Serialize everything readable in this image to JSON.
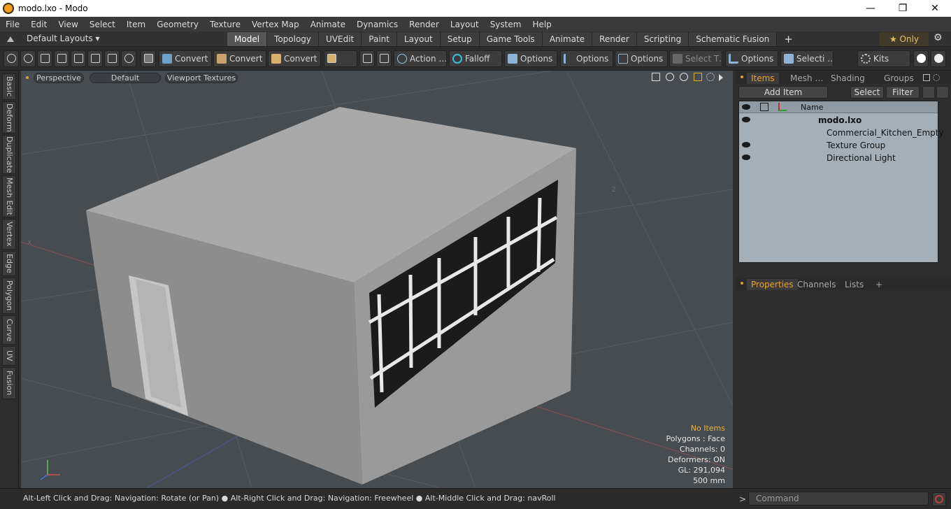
{
  "window": {
    "title": "modo.lxo - Modo",
    "minimize": "—",
    "maximize": "❐",
    "close": "✕"
  },
  "menu": [
    "File",
    "Edit",
    "View",
    "Select",
    "Item",
    "Geometry",
    "Texture",
    "Vertex Map",
    "Animate",
    "Dynamics",
    "Render",
    "Layout",
    "System",
    "Help"
  ],
  "layouts": {
    "label": "Default Layouts ▾",
    "tabs": [
      "Model",
      "Topology",
      "UVEdit",
      "Paint",
      "Layout",
      "Setup",
      "Game Tools",
      "Animate",
      "Render",
      "Scripting",
      "Schematic Fusion"
    ],
    "active": "Model",
    "add": "+",
    "only_label": "★ Only",
    "settings": "⚙"
  },
  "toolbar": {
    "convert1": "Convert",
    "convert2": "Convert",
    "convert3": "Convert",
    "action": "Action …",
    "falloff": "Falloff",
    "options1": "Options",
    "options2": "Options",
    "options3": "Options",
    "select_t": "Select T…",
    "options4": "Options",
    "selecti": "Selecti …",
    "kits": "Kits"
  },
  "left_tabs": [
    "Basic",
    "Deform",
    "Duplicate",
    "Mesh Edit",
    "Vertex",
    "Edge",
    "Polygon",
    "Curve",
    "UV",
    "Fusion"
  ],
  "viewport": {
    "perspective": "Perspective",
    "shading": "Default",
    "textures": "Viewport Textures",
    "axis_x": "X",
    "axis_z": "Z",
    "info": {
      "no_items": "No Items",
      "polygons": "Polygons : Face",
      "channels": "Channels: 0",
      "deformers": "Deformers: ON",
      "gl": "GL: 291,094",
      "scale": "500 mm"
    }
  },
  "items_panel": {
    "tabs": [
      "Items",
      "Mesh …",
      "Shading",
      "Groups"
    ],
    "active": "Items",
    "add_item": "Add Item",
    "select": "Select",
    "filter": "Filter",
    "name_header": "Name",
    "rows": [
      {
        "label": "modo.lxo",
        "bold": true
      },
      {
        "label": "Commercial_Kitchen_Empty"
      },
      {
        "label": "Texture Group"
      },
      {
        "label": "Directional Light"
      }
    ]
  },
  "props_panel": {
    "tabs": [
      "Properties",
      "Channels",
      "Lists"
    ],
    "active": "Properties",
    "add": "+"
  },
  "status": {
    "hint": "Alt-Left Click and Drag: Navigation: Rotate (or Pan) ● Alt-Right Click and Drag: Navigation: Freewheel ● Alt-Middle Click and Drag: navRoll",
    "command_placeholder": "Command",
    "prompt": ">"
  }
}
